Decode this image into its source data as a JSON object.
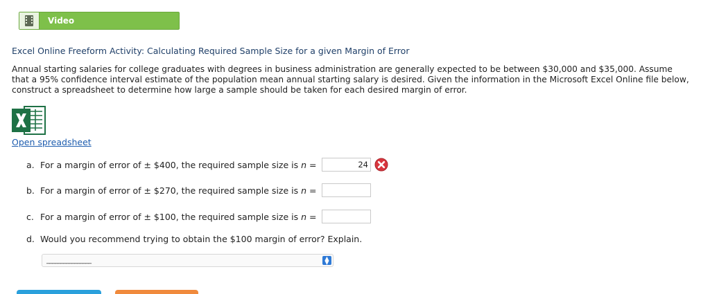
{
  "video": {
    "label": "Video",
    "icon": "film-icon"
  },
  "activity": {
    "title": "Excel Online Freeform Activity: Calculating Required Sample Size for a given Margin of Error",
    "description": "Annual starting salaries for college graduates with degrees in business administration are generally expected to be between $30,000 and $35,000. Assume that a 95% confidence interval estimate of the population mean annual starting salary is desired. Given the information in the Microsoft Excel Online file below, construct a spreadsheet to determine how large a sample should be taken for each desired margin of error.",
    "excel_icon": "excel-icon",
    "open_link": "Open spreadsheet"
  },
  "questions": [
    {
      "letter": "a.",
      "text": "For a margin of error of ± $400, the required sample size is ",
      "var": "n",
      "eq": " =",
      "answer": "24",
      "status": "incorrect"
    },
    {
      "letter": "b.",
      "text": "For a margin of error of ± $270, the required sample size is ",
      "var": "n",
      "eq": " =",
      "answer": ""
    },
    {
      "letter": "c.",
      "text": "For a margin of error of ± $100, the required sample size is ",
      "var": "n",
      "eq": " =",
      "answer": ""
    },
    {
      "letter": "d.",
      "text": "Would you recommend trying to obtain the $100 margin of error? Explain."
    }
  ],
  "explain_select": {
    "value": "________________"
  },
  "colors": {
    "video_bar": "#7ec04a",
    "title": "#1f3f68",
    "link": "#1d5cae",
    "wrong": "#d9363e",
    "excel_green": "#1e7145",
    "select_arrow": "#2f7ad6"
  }
}
